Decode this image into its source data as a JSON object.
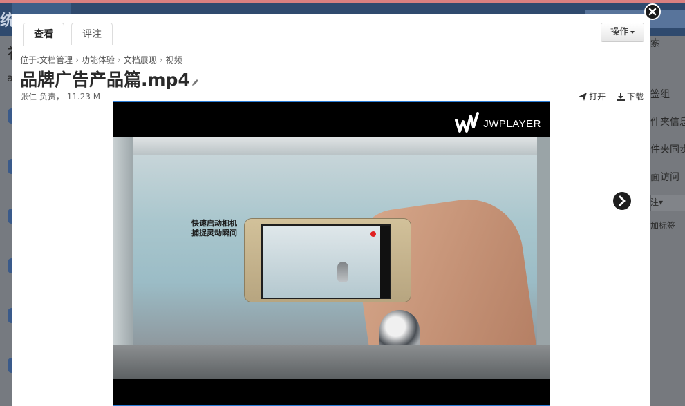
{
  "background": {
    "app_logo_fragment": "统",
    "left_text_1": "祁",
    "left_text_2": "a",
    "right_items": [
      "索",
      "签组",
      "件夹信息",
      "件夹同步",
      "面访问",
      "注▾",
      "加标签"
    ]
  },
  "modal": {
    "tabs": [
      {
        "label": "查看",
        "active": true
      },
      {
        "label": "评注",
        "active": false
      }
    ],
    "ops_label": "操作",
    "breadcrumb": {
      "prefix": "位于:",
      "items": [
        "文档管理",
        "功能体验",
        "文档展现",
        "视频"
      ],
      "separator": "›"
    },
    "title": "品牌广告产品篇.mp4",
    "meta": "张仁 负责， 11.23 M",
    "actions": {
      "open": "打开",
      "download": "下载"
    },
    "player": {
      "brand": "JWPLAYER",
      "caption_line1": "快速启动相机",
      "caption_line2": "捕捉灵动瞬间"
    }
  },
  "icons": {
    "close": "close-icon",
    "next": "chevron-right-icon",
    "pencil": "pencil-icon",
    "open": "send-icon",
    "download": "download-icon"
  },
  "colors": {
    "topbar": "#2f4a6e",
    "player_border": "#2a7bd4",
    "record": "#e02020"
  }
}
